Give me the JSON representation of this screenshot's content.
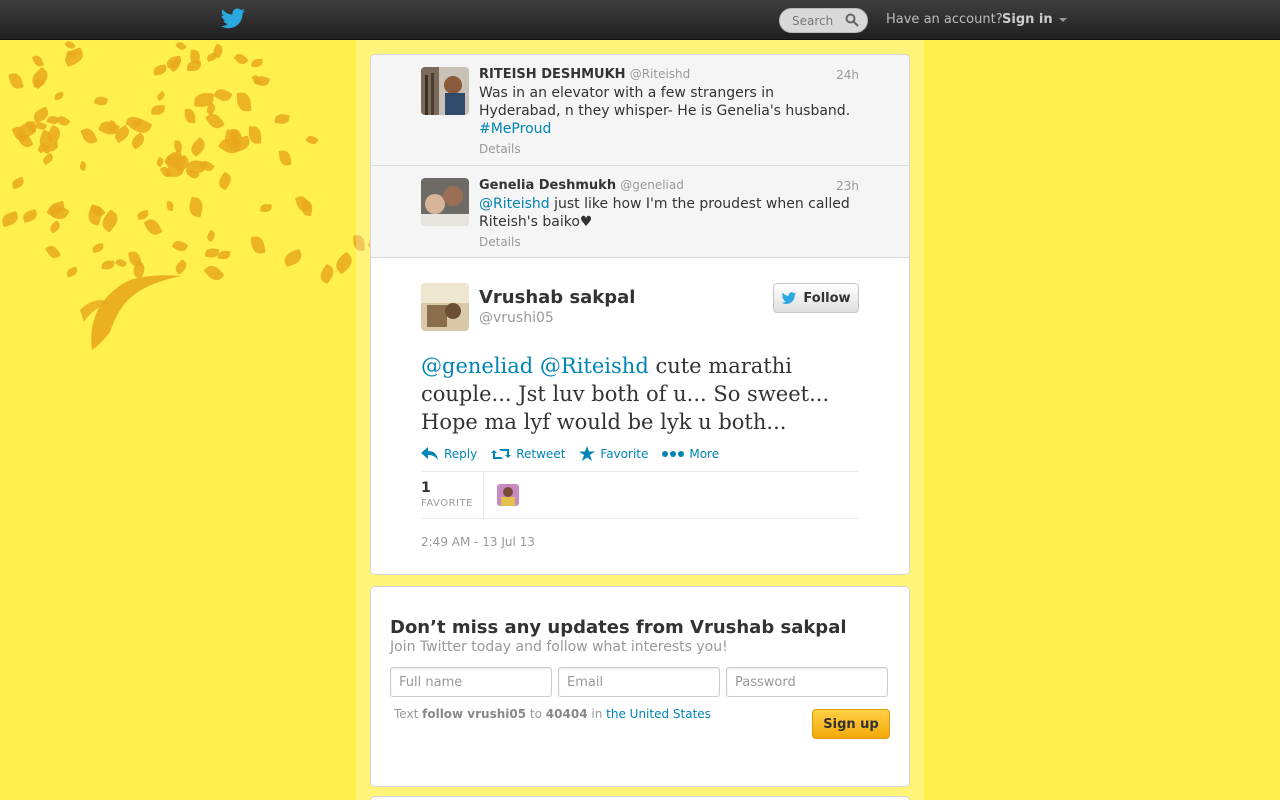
{
  "colors": {
    "page_bg": "#fff04e",
    "link": "#0084b4",
    "topbar": "#2a2a2a",
    "signup_button": "#f4a90a"
  },
  "topbar": {
    "logo_icon": "twitter-bird-icon",
    "search_placeholder": "Search",
    "have_account": "Have an account?",
    "signin_label": "Sign in"
  },
  "context_tweets": [
    {
      "name": "RITEISH DESHMUKH",
      "handle": "@Riteishd",
      "time": "24h",
      "text": "Was in an elevator with a few strangers in Hyderabad, n they whisper- He is Genelia's husband.",
      "hashtag": "#MeProud",
      "details": "Details"
    },
    {
      "name": "Genelia Deshmukh",
      "handle": "@geneliad",
      "time": "23h",
      "mention": "@Riteishd",
      "text": "just like how I'm the proudest when called Riteish's baiko♥",
      "details": "Details"
    }
  ],
  "main_tweet": {
    "name": "Vrushab sakpal",
    "handle": "@vrushi05",
    "follow_label": "Follow",
    "mention1": "@geneliad",
    "mention2": "@Riteishd",
    "text": "cute marathi couple... Jst luv both of u... So sweet... Hope ma lyf would be lyk u both...",
    "actions": {
      "reply": "Reply",
      "retweet": "Retweet",
      "favorite": "Favorite",
      "more": "More"
    },
    "favorite_count": "1",
    "favorite_label": "FAVORITE",
    "timestamp": "2:49 AM - 13 Jul 13"
  },
  "signup": {
    "title": "Don’t miss any updates from Vrushab sakpal",
    "subtitle": "Join Twitter today and follow what interests you!",
    "fullname_placeholder": "Full name",
    "email_placeholder": "Email",
    "password_placeholder": "Password",
    "sms_text": "Text",
    "sms_command": "follow vrushi05",
    "sms_to": "to",
    "sms_number": "40404",
    "sms_in": "in",
    "sms_country": "the United States",
    "button": "Sign up"
  }
}
